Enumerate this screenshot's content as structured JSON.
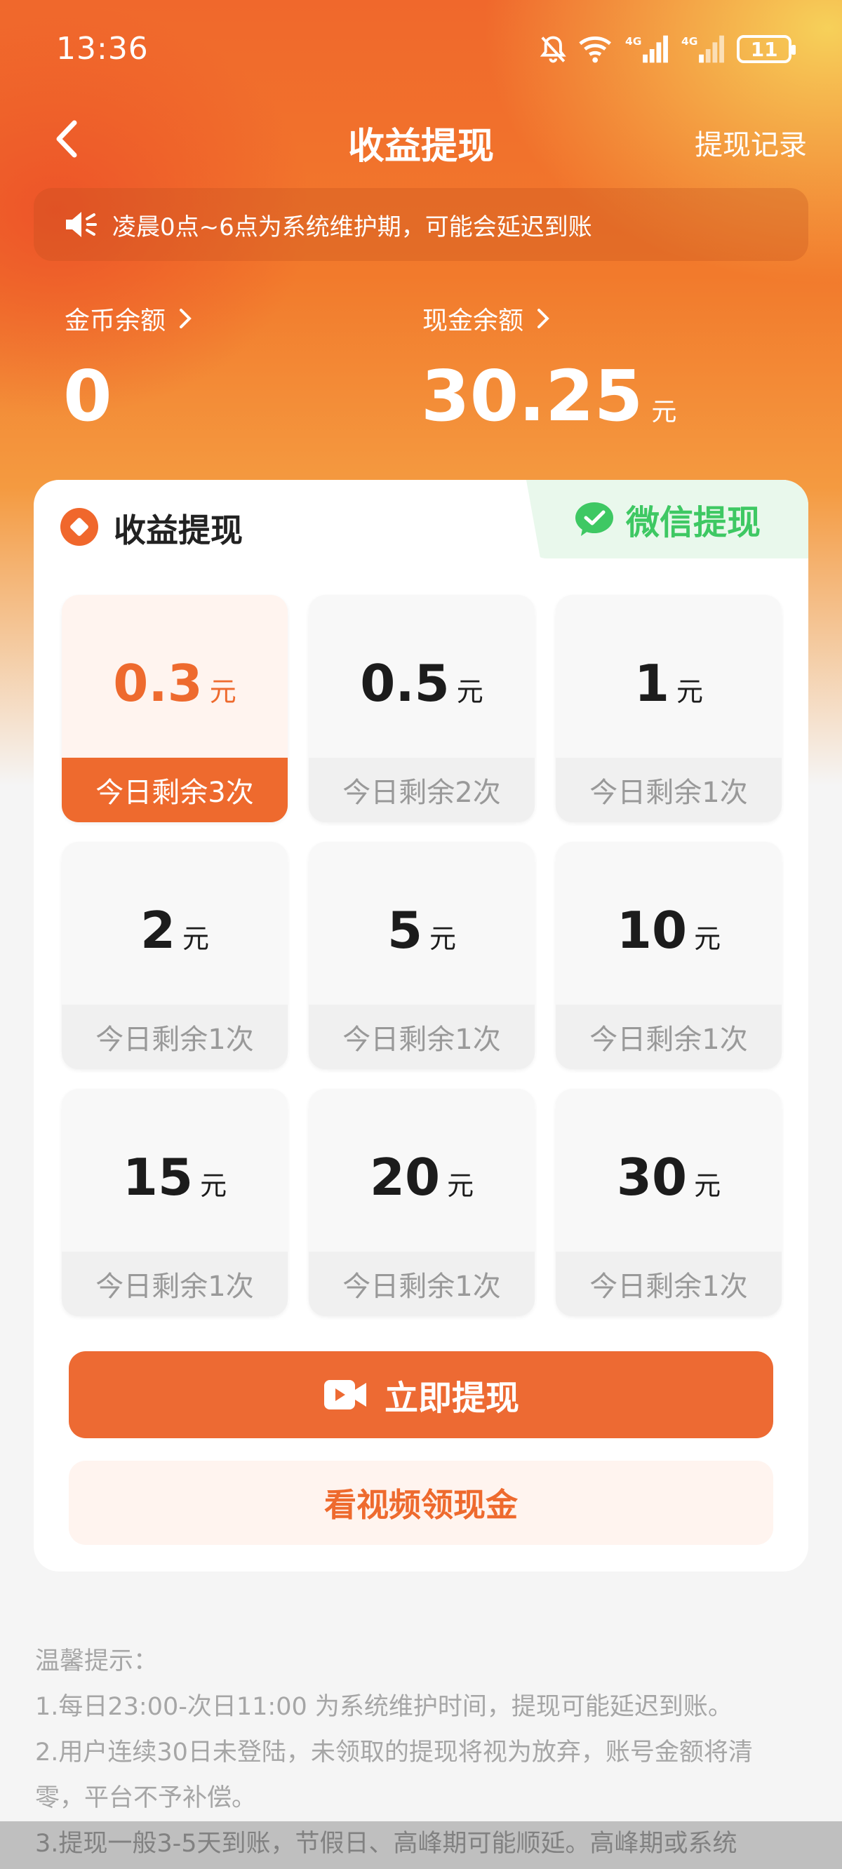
{
  "status_bar": {
    "time": "13:36",
    "battery": "11",
    "net_label_1": "4G",
    "net_label_2": "4G"
  },
  "nav": {
    "title": "收益提现",
    "right_link": "提现记录"
  },
  "notice": {
    "text": "凌晨0点~6点为系统维护期，可能会延迟到账"
  },
  "balances": {
    "coin": {
      "label": "金币余额",
      "value": "0"
    },
    "cash": {
      "label": "现金余额",
      "value": "30.25",
      "unit": "元"
    }
  },
  "card": {
    "title": "收益提现",
    "method": "微信提现",
    "options": [
      {
        "amount": "0.3",
        "unit": "元",
        "remaining": "今日剩余3次",
        "selected": true
      },
      {
        "amount": "0.5",
        "unit": "元",
        "remaining": "今日剩余2次"
      },
      {
        "amount": "1",
        "unit": "元",
        "remaining": "今日剩余1次"
      },
      {
        "amount": "2",
        "unit": "元",
        "remaining": "今日剩余1次"
      },
      {
        "amount": "5",
        "unit": "元",
        "remaining": "今日剩余1次"
      },
      {
        "amount": "10",
        "unit": "元",
        "remaining": "今日剩余1次"
      },
      {
        "amount": "15",
        "unit": "元",
        "remaining": "今日剩余1次"
      },
      {
        "amount": "20",
        "unit": "元",
        "remaining": "今日剩余1次"
      },
      {
        "amount": "30",
        "unit": "元",
        "remaining": "今日剩余1次"
      }
    ],
    "withdraw_button": "立即提现",
    "video_button": "看视频领现金"
  },
  "tips": {
    "title": "温馨提示：",
    "lines": [
      "1.每日23:00-次日11:00 为系统维护时间，提现可能延迟到账。",
      "2.用户连续30日未登陆，未领取的提现将视为放弃，账号金额将清",
      "零，平台不予补偿。",
      "3.提现一般3-5天到账，节假日、高峰期可能顺延。高峰期或系统"
    ]
  },
  "colors": {
    "accent": "#ED6A33",
    "wechat_green": "#3EC863"
  },
  "icons": [
    "mute-bell-icon",
    "wifi-icon",
    "signal-icon",
    "battery-icon",
    "back-arrow-icon",
    "speaker-icon",
    "chevron-right-icon",
    "diamond-icon",
    "wechat-icon",
    "video-camera-icon"
  ]
}
